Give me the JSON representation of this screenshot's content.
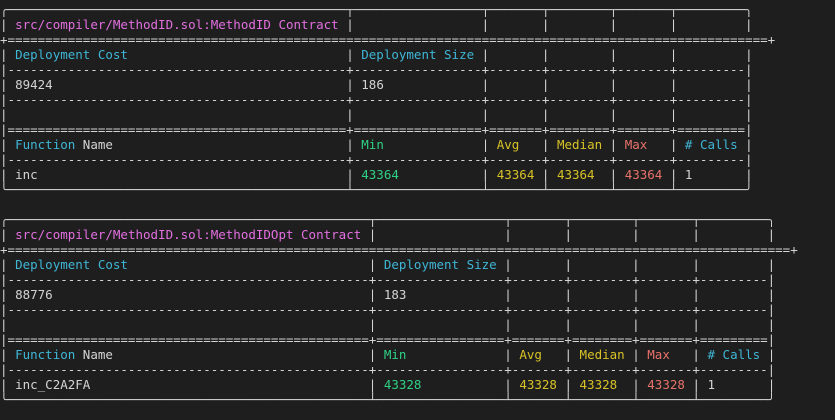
{
  "reports": [
    {
      "contract": "src/compiler/MethodID.sol:MethodID Contract",
      "deployment_headers": {
        "cost": "Deployment Cost",
        "size": "Deployment Size"
      },
      "deployment_values": {
        "cost": "89424",
        "size": "186"
      },
      "function_headers": {
        "function_word": "Function",
        "name_word": " Name",
        "min": "Min",
        "avg": "Avg",
        "median": "Median",
        "max": "Max",
        "calls": "# Calls"
      },
      "functions": [
        {
          "name": "inc",
          "min": "43364",
          "avg": "43364",
          "median": "43364",
          "max": "43364",
          "calls": "1"
        }
      ]
    },
    {
      "contract": "src/compiler/MethodID.sol:MethodIDOpt Contract",
      "deployment_headers": {
        "cost": "Deployment Cost",
        "size": "Deployment Size"
      },
      "deployment_values": {
        "cost": "88776",
        "size": "183"
      },
      "function_headers": {
        "function_word": "Function",
        "name_word": " Name",
        "min": "Min",
        "avg": "Avg",
        "median": "Median",
        "max": "Max",
        "calls": "# Calls"
      },
      "functions": [
        {
          "name": "inc_C2A2FA",
          "min": "43328",
          "avg": "43328",
          "median": "43328",
          "max": "43328",
          "calls": "1"
        }
      ]
    }
  ],
  "colors": {
    "background": "#1e1e1e",
    "text": "#d4d4d4",
    "contract_name": "#e36fe0",
    "header_cyan": "#3fb6d6",
    "min_green": "#2fd184",
    "avg_median_yellow": "#d8c227",
    "max_red": "#e8736a"
  }
}
